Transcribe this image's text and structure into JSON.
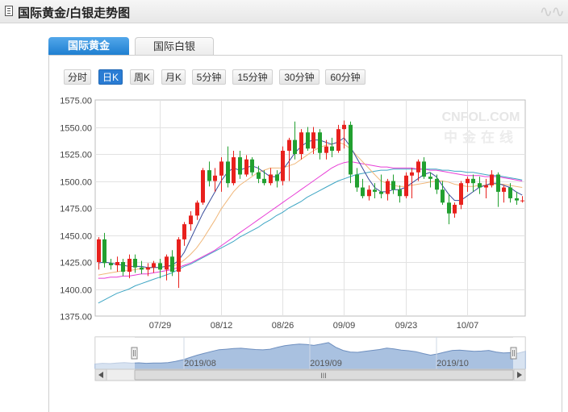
{
  "header": {
    "title": "国际黄金/白银走势图"
  },
  "tabs": [
    {
      "label": "国际黄金",
      "active": true
    },
    {
      "label": "国际白银",
      "active": false
    }
  ],
  "periods": [
    {
      "label": "分时",
      "active": false
    },
    {
      "label": "日K",
      "active": true
    },
    {
      "label": "周K",
      "active": false
    },
    {
      "label": "月K",
      "active": false
    },
    {
      "label": "5分钟",
      "active": false
    },
    {
      "label": "15分钟",
      "active": false
    },
    {
      "label": "30分钟",
      "active": false
    },
    {
      "label": "60分钟",
      "active": false
    }
  ],
  "watermark": {
    "brand": "CNFOL.COM",
    "sub": "中金在线"
  },
  "navigator": {
    "labels": [
      "2019/08",
      "2019/09",
      "2019/10"
    ],
    "scroll_thumb": "III"
  },
  "colors": {
    "up": "#e8211d",
    "down": "#22a030",
    "ma5": "#3a4d9c",
    "ma10": "#f0b77a",
    "ma20": "#e83dd6",
    "ma60": "#3fa6c4",
    "accent": "#2a7cd3"
  },
  "chart_data": {
    "type": "candlestick",
    "ylim": [
      1375,
      1575
    ],
    "yticks": [
      "1575.00",
      "1550.00",
      "1525.00",
      "1500.00",
      "1475.00",
      "1450.00",
      "1425.00",
      "1400.00",
      "1375.00"
    ],
    "xticks": [
      {
        "label": "07/29",
        "index": 10
      },
      {
        "label": "08/12",
        "index": 20
      },
      {
        "label": "08/26",
        "index": 30
      },
      {
        "label": "09/09",
        "index": 40
      },
      {
        "label": "09/23",
        "index": 50
      },
      {
        "label": "10/07",
        "index": 60
      }
    ],
    "candles": [
      [
        1425,
        1448,
        1418,
        1446
      ],
      [
        1446,
        1452,
        1420,
        1424
      ],
      [
        1424,
        1428,
        1418,
        1422
      ],
      [
        1422,
        1430,
        1416,
        1425
      ],
      [
        1425,
        1428,
        1412,
        1416
      ],
      [
        1416,
        1432,
        1410,
        1428
      ],
      [
        1428,
        1432,
        1415,
        1420
      ],
      [
        1420,
        1426,
        1414,
        1418
      ],
      [
        1418,
        1424,
        1412,
        1420
      ],
      [
        1420,
        1426,
        1415,
        1424
      ],
      [
        1424,
        1428,
        1410,
        1418
      ],
      [
        1418,
        1432,
        1408,
        1430
      ],
      [
        1430,
        1436,
        1412,
        1416
      ],
      [
        1416,
        1448,
        1401,
        1446
      ],
      [
        1446,
        1462,
        1440,
        1460
      ],
      [
        1460,
        1472,
        1454,
        1468
      ],
      [
        1468,
        1482,
        1464,
        1480
      ],
      [
        1480,
        1512,
        1478,
        1510
      ],
      [
        1510,
        1518,
        1495,
        1500
      ],
      [
        1500,
        1512,
        1490,
        1505
      ],
      [
        1505,
        1522,
        1490,
        1518
      ],
      [
        1518,
        1532,
        1494,
        1498
      ],
      [
        1498,
        1528,
        1496,
        1522
      ],
      [
        1522,
        1528,
        1502,
        1506
      ],
      [
        1506,
        1524,
        1504,
        1520
      ],
      [
        1520,
        1522,
        1505,
        1508
      ],
      [
        1508,
        1514,
        1498,
        1502
      ],
      [
        1502,
        1510,
        1496,
        1498
      ],
      [
        1498,
        1512,
        1496,
        1506
      ],
      [
        1506,
        1510,
        1494,
        1500
      ],
      [
        1500,
        1532,
        1496,
        1528
      ],
      [
        1528,
        1540,
        1500,
        1538
      ],
      [
        1538,
        1555,
        1520,
        1525
      ],
      [
        1525,
        1548,
        1520,
        1545
      ],
      [
        1545,
        1550,
        1528,
        1530
      ],
      [
        1530,
        1550,
        1525,
        1545
      ],
      [
        1545,
        1548,
        1520,
        1526
      ],
      [
        1526,
        1538,
        1520,
        1532
      ],
      [
        1532,
        1540,
        1522,
        1528
      ],
      [
        1528,
        1552,
        1526,
        1548
      ],
      [
        1548,
        1556,
        1530,
        1552
      ],
      [
        1552,
        1555,
        1498,
        1506
      ],
      [
        1506,
        1512,
        1490,
        1494
      ],
      [
        1494,
        1502,
        1484,
        1486
      ],
      [
        1486,
        1496,
        1482,
        1492
      ],
      [
        1492,
        1498,
        1484,
        1490
      ],
      [
        1490,
        1506,
        1484,
        1488
      ],
      [
        1488,
        1502,
        1482,
        1500
      ],
      [
        1500,
        1506,
        1488,
        1492
      ],
      [
        1492,
        1496,
        1480,
        1486
      ],
      [
        1486,
        1508,
        1484,
        1505
      ],
      [
        1505,
        1512,
        1484,
        1508
      ],
      [
        1508,
        1520,
        1500,
        1518
      ],
      [
        1518,
        1522,
        1502,
        1504
      ],
      [
        1504,
        1508,
        1494,
        1502
      ],
      [
        1502,
        1506,
        1488,
        1492
      ],
      [
        1492,
        1500,
        1478,
        1480
      ],
      [
        1480,
        1488,
        1460,
        1470
      ],
      [
        1470,
        1480,
        1466,
        1478
      ],
      [
        1478,
        1500,
        1474,
        1498
      ],
      [
        1498,
        1504,
        1490,
        1502
      ],
      [
        1502,
        1506,
        1490,
        1498
      ],
      [
        1498,
        1504,
        1488,
        1494
      ],
      [
        1494,
        1502,
        1484,
        1496
      ],
      [
        1496,
        1510,
        1494,
        1506
      ],
      [
        1506,
        1508,
        1476,
        1490
      ],
      [
        1490,
        1496,
        1480,
        1494
      ],
      [
        1494,
        1498,
        1480,
        1484
      ],
      [
        1484,
        1490,
        1478,
        1482
      ],
      [
        1482,
        1486,
        1480,
        1482
      ]
    ],
    "ma5": [
      1424,
      1425,
      1424,
      1423,
      1422,
      1421,
      1421,
      1421,
      1420,
      1420,
      1420,
      1421,
      1422,
      1426,
      1434,
      1446,
      1458,
      1470,
      1480,
      1490,
      1500,
      1508,
      1512,
      1510,
      1512,
      1514,
      1512,
      1508,
      1504,
      1504,
      1510,
      1518,
      1526,
      1532,
      1536,
      1538,
      1538,
      1536,
      1534,
      1536,
      1540,
      1532,
      1522,
      1512,
      1502,
      1494,
      1490,
      1490,
      1492,
      1492,
      1494,
      1498,
      1502,
      1506,
      1508,
      1504,
      1496,
      1488,
      1482,
      1482,
      1486,
      1490,
      1494,
      1496,
      1498,
      1498,
      1496,
      1494,
      1490,
      1487
    ],
    "ma10": [
      1413,
      1414,
      1415,
      1416,
      1417,
      1417,
      1418,
      1419,
      1419,
      1420,
      1420,
      1421,
      1421,
      1423,
      1427,
      1432,
      1438,
      1446,
      1455,
      1464,
      1474,
      1482,
      1490,
      1496,
      1500,
      1504,
      1508,
      1510,
      1512,
      1512,
      1512,
      1514,
      1516,
      1520,
      1524,
      1528,
      1531,
      1533,
      1534,
      1536,
      1534,
      1530,
      1524,
      1518,
      1512,
      1506,
      1500,
      1498,
      1496,
      1495,
      1495,
      1496,
      1497,
      1498,
      1499,
      1500,
      1500,
      1499,
      1497,
      1496,
      1495,
      1495,
      1496,
      1496,
      1497,
      1497,
      1497,
      1496,
      1495,
      1494
    ],
    "ma20": [
      1410,
      1410,
      1411,
      1411,
      1412,
      1412,
      1413,
      1414,
      1414,
      1415,
      1416,
      1417,
      1418,
      1420,
      1422,
      1424,
      1427,
      1430,
      1433,
      1436,
      1440,
      1444,
      1448,
      1452,
      1456,
      1460,
      1464,
      1468,
      1472,
      1476,
      1480,
      1484,
      1488,
      1492,
      1496,
      1500,
      1504,
      1508,
      1512,
      1515,
      1517,
      1518,
      1517,
      1516,
      1515,
      1514,
      1513,
      1513,
      1512,
      1512,
      1512,
      1512,
      1511,
      1511,
      1510,
      1510,
      1509,
      1508,
      1507,
      1506,
      1505,
      1505,
      1505,
      1504,
      1504,
      1504,
      1503,
      1502,
      1501,
      1500
    ],
    "ma60": [
      1387,
      1390,
      1393,
      1396,
      1398,
      1400,
      1403,
      1405,
      1407,
      1409,
      1411,
      1413,
      1415,
      1418,
      1421,
      1423,
      1426,
      1429,
      1432,
      1435,
      1438,
      1441,
      1444,
      1448,
      1451,
      1454,
      1457,
      1461,
      1464,
      1468,
      1471,
      1475,
      1478,
      1481,
      1485,
      1488,
      1491,
      1494,
      1497,
      1500,
      1502,
      1504,
      1506,
      1507,
      1508,
      1509,
      1510,
      1510,
      1511,
      1511,
      1511,
      1511,
      1511,
      1511,
      1511,
      1511,
      1510,
      1510,
      1509,
      1509,
      1508,
      1508,
      1507,
      1506,
      1505,
      1505,
      1504,
      1503,
      1502,
      1501
    ],
    "navigator": {
      "values": [
        1414,
        1418,
        1416,
        1420,
        1422,
        1419,
        1421,
        1418,
        1420,
        1420,
        1422,
        1430,
        1440,
        1455,
        1470,
        1482,
        1494,
        1505,
        1508,
        1512,
        1514,
        1510,
        1506,
        1504,
        1508,
        1520,
        1530,
        1536,
        1540,
        1538,
        1532,
        1540,
        1550,
        1520,
        1500,
        1490,
        1488,
        1494,
        1500,
        1506,
        1515,
        1510,
        1502,
        1498,
        1492,
        1480,
        1470,
        1478,
        1490,
        1500,
        1502,
        1498,
        1494,
        1496,
        1500,
        1490,
        1484,
        1486,
        1482,
        1494
      ]
    }
  }
}
